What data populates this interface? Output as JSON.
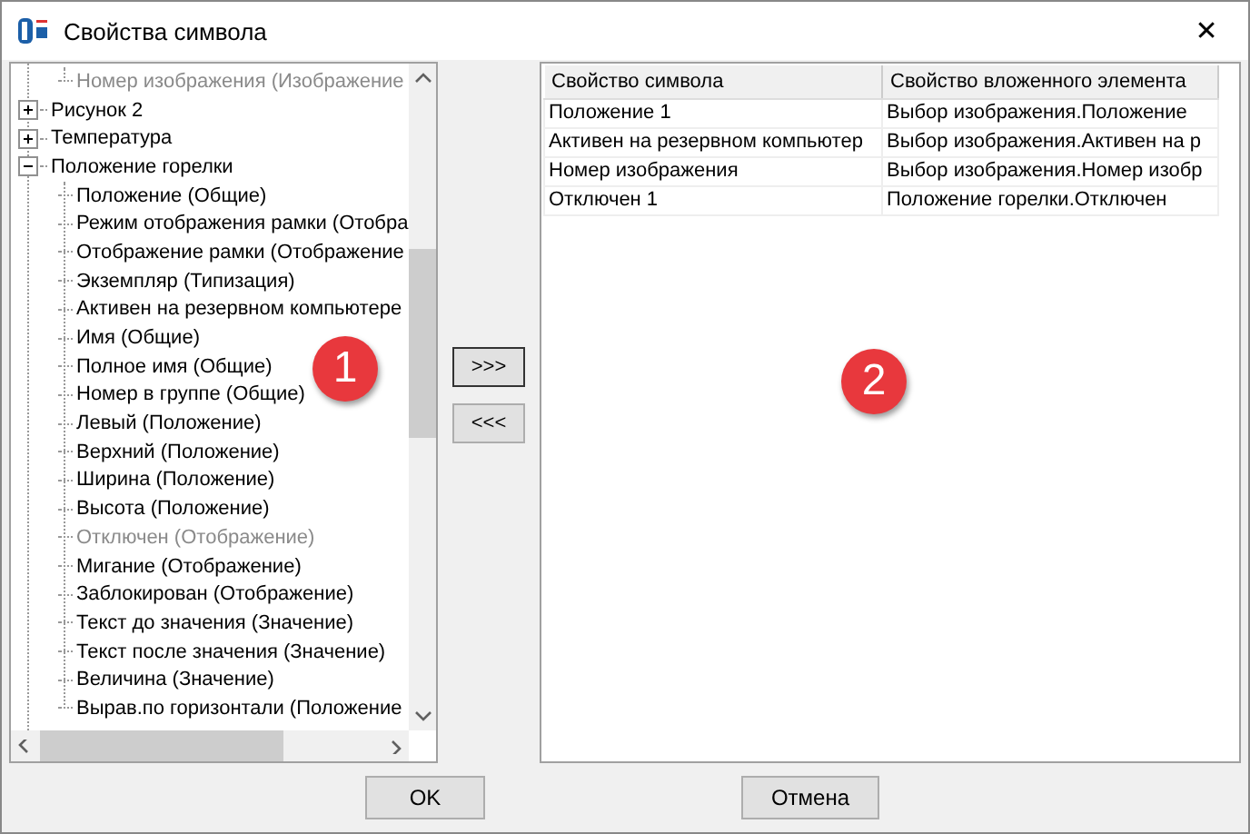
{
  "window": {
    "title": "Свойства символа",
    "close": "✕"
  },
  "tree": {
    "continued_children": [
      {
        "label": "Номер изображения (Изображение",
        "disabled": true
      }
    ],
    "nodes": [
      {
        "label": "Рисунок 2",
        "expanded": false
      },
      {
        "label": "Температура",
        "expanded": false
      },
      {
        "label": "Положение горелки",
        "expanded": true,
        "children": [
          {
            "label": "Положение (Общие)",
            "disabled": false
          },
          {
            "label": "Режим отображения рамки (Отобра",
            "disabled": false
          },
          {
            "label": "Отображение рамки (Отображение",
            "disabled": false
          },
          {
            "label": "Экземпляр (Типизация)",
            "disabled": false
          },
          {
            "label": "Активен на резервном компьютере",
            "disabled": false
          },
          {
            "label": "Имя (Общие)",
            "disabled": false
          },
          {
            "label": "Полное имя (Общие)",
            "disabled": false
          },
          {
            "label": "Номер в группе (Общие)",
            "disabled": false
          },
          {
            "label": "Левый (Положение)",
            "disabled": false
          },
          {
            "label": "Верхний (Положение)",
            "disabled": false
          },
          {
            "label": "Ширина (Положение)",
            "disabled": false
          },
          {
            "label": "Высота (Положение)",
            "disabled": false
          },
          {
            "label": "Отключен (Отображение)",
            "disabled": true
          },
          {
            "label": "Мигание (Отображение)",
            "disabled": false
          },
          {
            "label": "Заблокирован (Отображение)",
            "disabled": false
          },
          {
            "label": "Текст до значения (Значение)",
            "disabled": false
          },
          {
            "label": "Текст после значения (Значение)",
            "disabled": false
          },
          {
            "label": "Величина (Значение)",
            "disabled": false
          },
          {
            "label": "Вырав.по горизонтали (Положение",
            "disabled": false
          }
        ]
      }
    ]
  },
  "move_buttons": [
    ">>>",
    "<<<"
  ],
  "table": {
    "columns": [
      "Свойство символа",
      "Свойство вложенного элемента"
    ],
    "rows": [
      [
        "Положение 1",
        "Выбор изображения.Положение"
      ],
      [
        "Активен на резервном компьютер",
        "Выбор изображения.Активен на р"
      ],
      [
        "Номер изображения",
        "Выбор изображения.Номер изобр"
      ],
      [
        "Отключен 1",
        "Положение горелки.Отключен"
      ]
    ]
  },
  "callouts": [
    "1",
    "2"
  ],
  "buttons": [
    "OK",
    "Отмена"
  ]
}
